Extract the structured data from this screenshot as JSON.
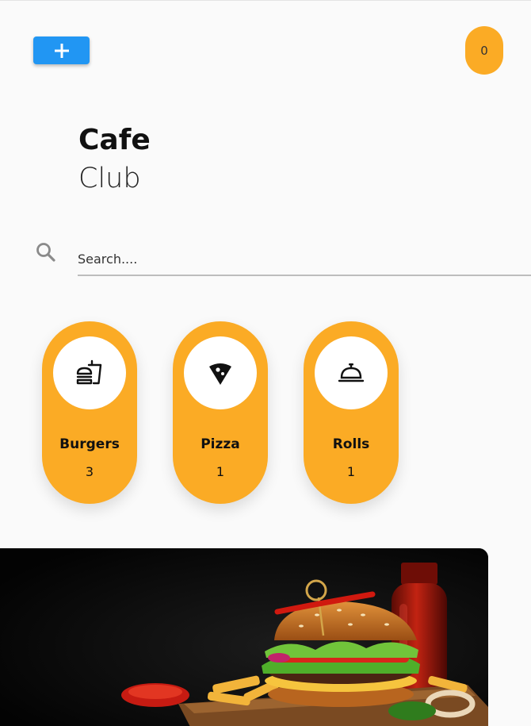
{
  "header": {
    "add_label": "+",
    "cart_count": "0"
  },
  "brand": {
    "title": "Cafe",
    "subtitle": "Club"
  },
  "search": {
    "placeholder": "Search...."
  },
  "categories": [
    {
      "name": "Burgers",
      "count": "3",
      "icon": "fastfood-icon"
    },
    {
      "name": "Pizza",
      "count": "1",
      "icon": "pizza-icon"
    },
    {
      "name": "Rolls",
      "count": "1",
      "icon": "room-service-icon"
    }
  ],
  "colors": {
    "accent": "#fbab25",
    "primary_button": "#2196f3",
    "background": "#fafafa"
  }
}
